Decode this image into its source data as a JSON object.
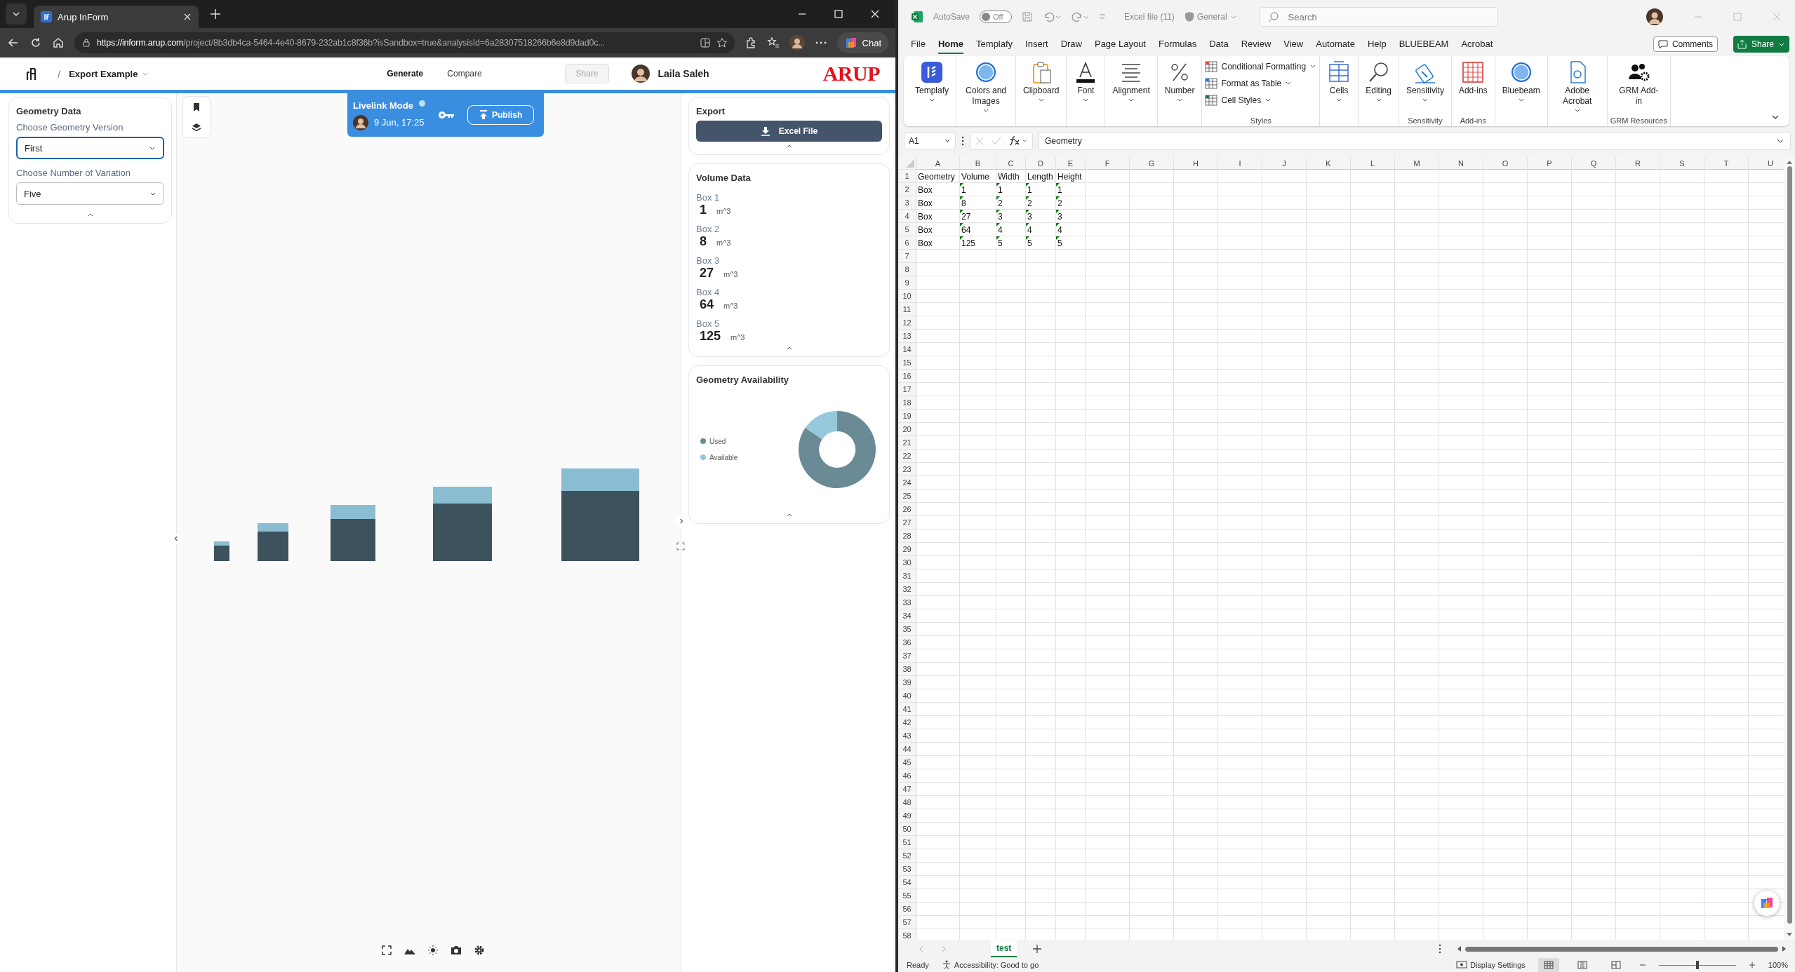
{
  "browser": {
    "tabs": [
      {
        "title": "Arup InForm",
        "selected": true
      }
    ],
    "url": {
      "host": "https://inform.arup.com",
      "path": "/project/8b3db4ca-5464-4e40-8679-232ab1c8f36b?isSandbox=true&analysisId=6a28307518266b6e8d9dad0c..."
    },
    "chat": "Chat"
  },
  "app": {
    "breadcrumb_separator": "/",
    "breadcrumb": "Export Example",
    "nav": [
      {
        "label": "Generate",
        "selected": true
      },
      {
        "label": "Compare",
        "selected": false
      }
    ],
    "share": {
      "label": "Share",
      "disabled": true
    },
    "user": "Laila Saleh",
    "logo": "ARUP"
  },
  "geometry_panel": {
    "title": "Geometry Data",
    "fields": [
      {
        "label": "Choose Geometry Version",
        "value": "First",
        "focused": true
      },
      {
        "label": "Choose Number of Variation",
        "value": "Five",
        "focused": false
      }
    ]
  },
  "livelink": {
    "title": "Livelink Mode",
    "time": "9 Jun, 17:25",
    "publish": "Publish"
  },
  "export": {
    "title": "Export",
    "button": "Excel File"
  },
  "volume": {
    "title": "Volume Data",
    "items": [
      {
        "label": "Box 1",
        "value": "1",
        "unit": "m^3"
      },
      {
        "label": "Box 2",
        "value": "8",
        "unit": "m^3"
      },
      {
        "label": "Box 3",
        "value": "27",
        "unit": "m^3"
      },
      {
        "label": "Box 4",
        "value": "64",
        "unit": "m^3"
      },
      {
        "label": "Box 5",
        "value": "125",
        "unit": "m^3"
      }
    ]
  },
  "availability": {
    "title": "Geometry Availability",
    "legend": [
      {
        "label": "Used",
        "color": "#6a8b96"
      },
      {
        "label": "Available",
        "color": "#96c8dc"
      }
    ]
  },
  "excel": {
    "autosave": {
      "label": "AutoSave",
      "state": "Off",
      "on": false
    },
    "file": "Excel file (11)",
    "sensitivity": "General",
    "search": {
      "placeholder": "Search"
    },
    "menu": [
      {
        "label": "File",
        "selected": false
      },
      {
        "label": "Home",
        "selected": true
      },
      {
        "label": "Templafy",
        "selected": false
      },
      {
        "label": "Insert",
        "selected": false
      },
      {
        "label": "Draw",
        "selected": false
      },
      {
        "label": "Page Layout",
        "selected": false
      },
      {
        "label": "Formulas",
        "selected": false
      },
      {
        "label": "Data",
        "selected": false
      },
      {
        "label": "Review",
        "selected": false
      },
      {
        "label": "View",
        "selected": false
      },
      {
        "label": "Automate",
        "selected": false
      },
      {
        "label": "Help",
        "selected": false
      },
      {
        "label": "BLUEBEAM",
        "selected": false
      },
      {
        "label": "Acrobat",
        "selected": false
      }
    ],
    "comments": "Comments",
    "share": "Share",
    "ribbon": [
      {
        "items": [
          {
            "label": "Templafy",
            "kind": "large",
            "dropdown": true
          }
        ]
      },
      {
        "items": [
          {
            "label": "Colors and Images",
            "kind": "large",
            "dropdown": true
          }
        ]
      },
      {
        "items": [
          {
            "label": "Clipboard",
            "kind": "large",
            "dropdown": true
          }
        ]
      },
      {
        "items": [
          {
            "label": "Font",
            "kind": "large",
            "dropdown": true
          }
        ]
      },
      {
        "items": [
          {
            "label": "Alignment",
            "kind": "large",
            "dropdown": true
          }
        ]
      },
      {
        "items": [
          {
            "label": "Number",
            "kind": "large",
            "dropdown": true
          }
        ]
      },
      {
        "label": "Styles",
        "items": [
          {
            "label": "Conditional Formatting",
            "kind": "small",
            "dropdown": true
          },
          {
            "label": "Format as Table",
            "kind": "small",
            "dropdown": true
          },
          {
            "label": "Cell Styles",
            "kind": "small",
            "dropdown": true
          }
        ]
      },
      {
        "items": [
          {
            "label": "Cells",
            "kind": "large",
            "dropdown": true
          }
        ]
      },
      {
        "items": [
          {
            "label": "Editing",
            "kind": "large",
            "dropdown": true
          }
        ]
      },
      {
        "label": "Sensitivity",
        "items": [
          {
            "label": "Sensitivity",
            "kind": "large",
            "dropdown": true
          }
        ]
      },
      {
        "label": "Add-ins",
        "items": [
          {
            "label": "Add-ins",
            "kind": "large",
            "dropdown": false
          }
        ]
      },
      {
        "items": [
          {
            "label": "Bluebeam",
            "kind": "large",
            "dropdown": true
          }
        ]
      },
      {
        "items": [
          {
            "label": "Adobe Acrobat",
            "kind": "large",
            "dropdown": true
          }
        ]
      },
      {
        "label": "GRM Resources",
        "items": [
          {
            "label": "GRM Add-in",
            "kind": "large",
            "dropdown": false
          }
        ]
      }
    ],
    "name_box": "A1",
    "formula": "Geometry",
    "columns": [
      "A",
      "B",
      "C",
      "D",
      "E",
      "F",
      "G",
      "H",
      "I",
      "J",
      "K",
      "L",
      "M",
      "N",
      "O",
      "P",
      "Q",
      "R",
      "S",
      "T",
      "U"
    ],
    "rows": [
      {
        "number": "1",
        "cells": [
          {
            "text": "Geometry",
            "flagged": false
          },
          {
            "text": "Volume",
            "flagged": false
          },
          {
            "text": "Width",
            "flagged": false
          },
          {
            "text": "Length",
            "flagged": false
          },
          {
            "text": "Height",
            "flagged": false
          }
        ]
      },
      {
        "number": "2",
        "cells": [
          {
            "text": "Box",
            "flagged": false
          },
          {
            "text": "1",
            "flagged": true
          },
          {
            "text": "1",
            "flagged": true
          },
          {
            "text": "1",
            "flagged": true
          },
          {
            "text": "1",
            "flagged": true
          }
        ]
      },
      {
        "number": "3",
        "cells": [
          {
            "text": "Box",
            "flagged": false
          },
          {
            "text": "8",
            "flagged": true
          },
          {
            "text": "2",
            "flagged": true
          },
          {
            "text": "2",
            "flagged": true
          },
          {
            "text": "2",
            "flagged": true
          }
        ]
      },
      {
        "number": "4",
        "cells": [
          {
            "text": "Box",
            "flagged": false
          },
          {
            "text": "27",
            "flagged": true
          },
          {
            "text": "3",
            "flagged": true
          },
          {
            "text": "3",
            "flagged": true
          },
          {
            "text": "3",
            "flagged": true
          }
        ]
      },
      {
        "number": "5",
        "cells": [
          {
            "text": "Box",
            "flagged": false
          },
          {
            "text": "64",
            "flagged": true
          },
          {
            "text": "4",
            "flagged": true
          },
          {
            "text": "4",
            "flagged": true
          },
          {
            "text": "4",
            "flagged": true
          }
        ]
      },
      {
        "number": "6",
        "cells": [
          {
            "text": "Box",
            "flagged": false
          },
          {
            "text": "125",
            "flagged": true
          },
          {
            "text": "5",
            "flagged": true
          },
          {
            "text": "5",
            "flagged": true
          },
          {
            "text": "5",
            "flagged": true
          }
        ]
      },
      {
        "number": "7"
      },
      {
        "number": "8"
      },
      {
        "number": "9"
      },
      {
        "number": "10"
      },
      {
        "number": "11"
      },
      {
        "number": "12"
      },
      {
        "number": "13"
      },
      {
        "number": "14"
      },
      {
        "number": "15"
      },
      {
        "number": "16"
      },
      {
        "number": "17"
      },
      {
        "number": "18"
      },
      {
        "number": "19"
      },
      {
        "number": "20"
      },
      {
        "number": "21"
      },
      {
        "number": "22"
      },
      {
        "number": "23"
      },
      {
        "number": "24"
      },
      {
        "number": "25"
      },
      {
        "number": "26"
      },
      {
        "number": "27"
      },
      {
        "number": "28"
      },
      {
        "number": "29"
      },
      {
        "number": "30"
      },
      {
        "number": "31"
      },
      {
        "number": "32"
      },
      {
        "number": "33"
      },
      {
        "number": "34"
      },
      {
        "number": "35"
      },
      {
        "number": "36"
      },
      {
        "number": "37"
      },
      {
        "number": "38"
      },
      {
        "number": "39"
      },
      {
        "number": "40"
      },
      {
        "number": "41"
      },
      {
        "number": "42"
      },
      {
        "number": "43"
      },
      {
        "number": "44"
      },
      {
        "number": "45"
      },
      {
        "number": "46"
      },
      {
        "number": "47"
      },
      {
        "number": "48"
      },
      {
        "number": "49"
      },
      {
        "number": "50"
      },
      {
        "number": "51"
      },
      {
        "number": "52"
      },
      {
        "number": "53"
      },
      {
        "number": "54"
      },
      {
        "number": "55"
      },
      {
        "number": "56"
      },
      {
        "number": "57"
      },
      {
        "number": "58"
      }
    ],
    "sheets": [
      {
        "name": "test",
        "selected": true
      }
    ],
    "status": {
      "ready": "Ready",
      "accessibility": "Accessibility: Good to go",
      "display": "Display Settings",
      "views": [
        {
          "selected": true
        },
        {
          "selected": false
        },
        {
          "selected": false
        }
      ],
      "zoom": {
        "level": 0.5,
        "reading": "100%"
      }
    }
  }
}
